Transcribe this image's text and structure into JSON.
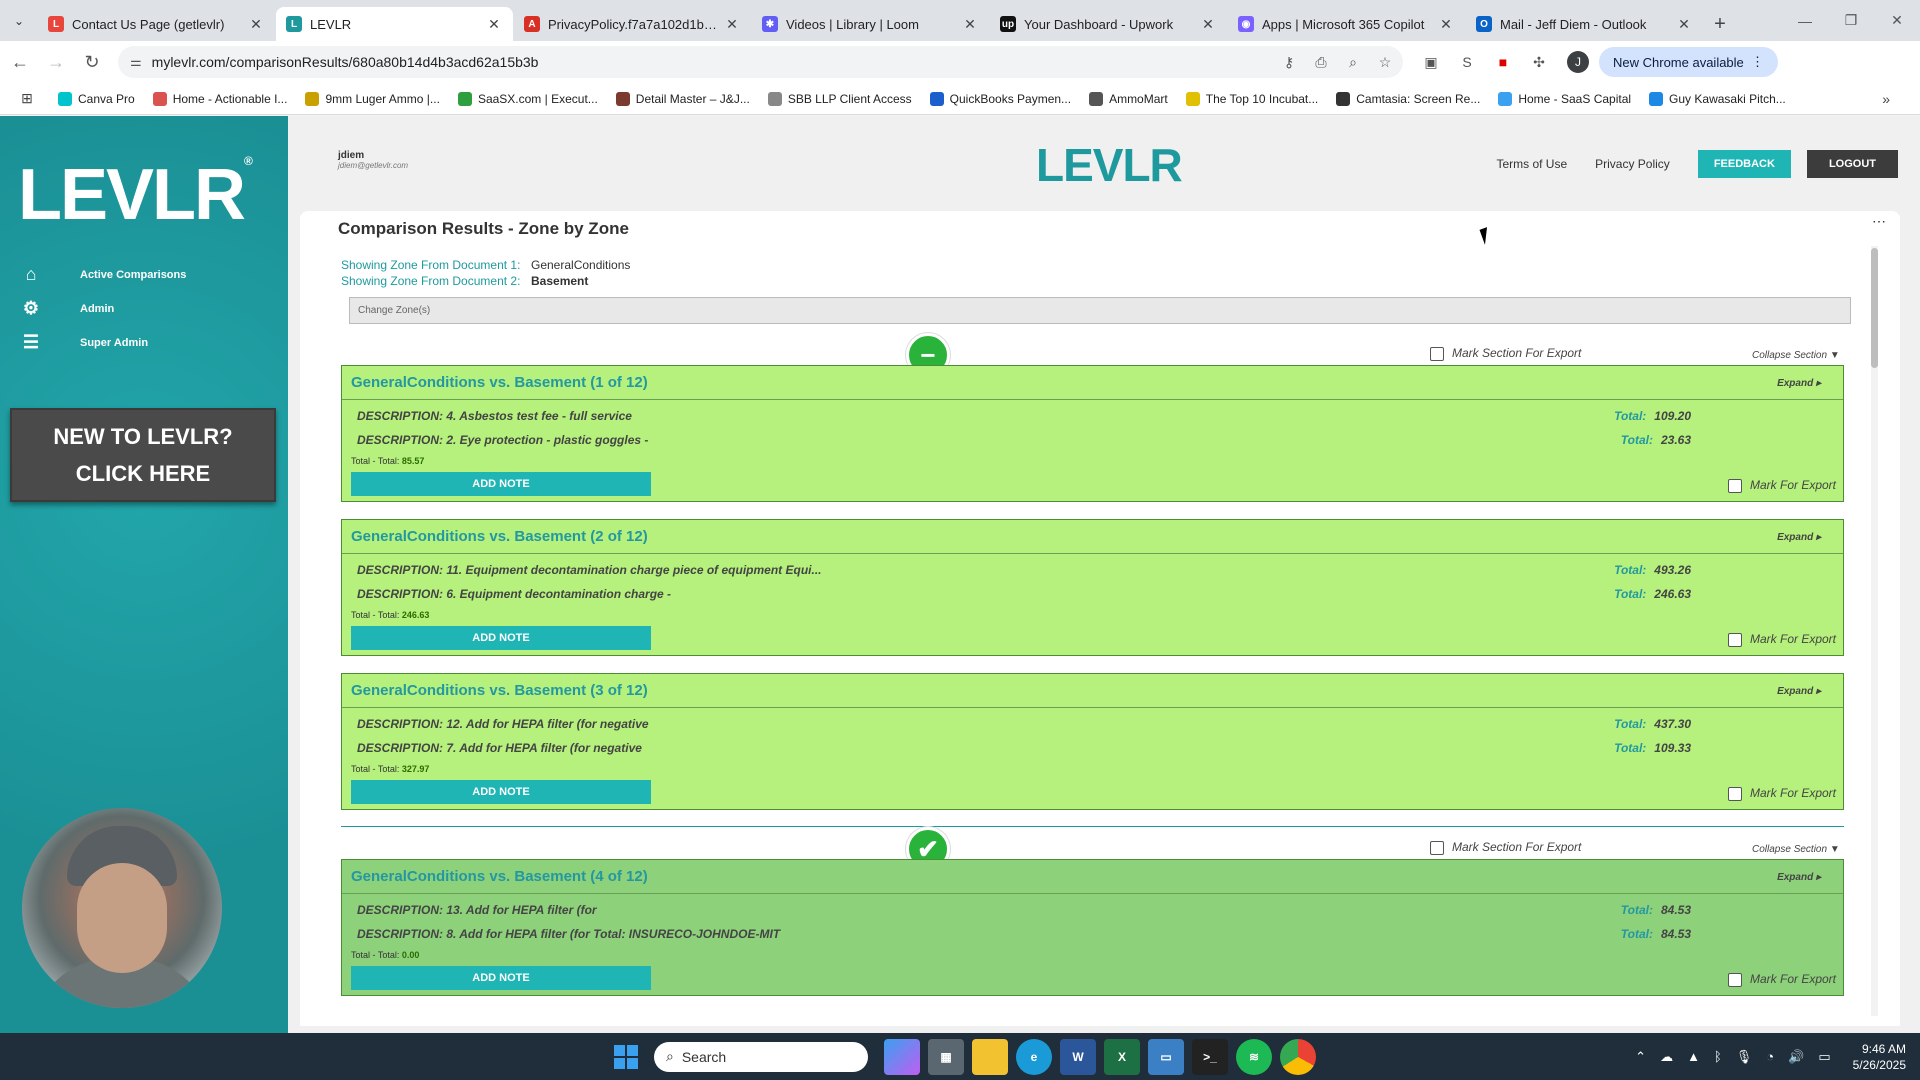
{
  "browser": {
    "tabs": [
      {
        "title": "Contact Us Page (getlevlr)",
        "color": "#e8453c",
        "glyph": "L"
      },
      {
        "title": "LEVLR",
        "color": "#1e9a9f",
        "glyph": "L",
        "active": true
      },
      {
        "title": "PrivacyPolicy.f7a7a102d1b144b",
        "color": "#d93025",
        "glyph": "A"
      },
      {
        "title": "Videos | Library | Loom",
        "color": "#625df5",
        "glyph": "✱"
      },
      {
        "title": "Your Dashboard - Upwork",
        "color": "#111",
        "glyph": "up"
      },
      {
        "title": "Apps | Microsoft 365 Copilot",
        "color": "#7b61ff",
        "glyph": "◉"
      },
      {
        "title": "Mail - Jeff Diem - Outlook",
        "color": "#0a64c8",
        "glyph": "O"
      }
    ],
    "url": "mylevlr.com/comparisonResults/680a80b14d4b3acd62a15b3b",
    "profile_initial": "J",
    "update_label": "New Chrome available",
    "bookmarks": [
      {
        "label": "Canva Pro",
        "color": "#00c4cc"
      },
      {
        "label": "Home - Actionable I...",
        "color": "#d9534f"
      },
      {
        "label": "9mm Luger Ammo |...",
        "color": "#c8a100"
      },
      {
        "label": "SaaSX.com | Execut...",
        "color": "#2e9e3e"
      },
      {
        "label": "Detail Master – J&J...",
        "color": "#7a3b2e"
      },
      {
        "label": "SBB LLP Client Access",
        "color": "#888"
      },
      {
        "label": "QuickBooks Paymen...",
        "color": "#1c5fcc"
      },
      {
        "label": "AmmoMart",
        "color": "#555"
      },
      {
        "label": "The Top 10 Incubat...",
        "color": "#e0c000"
      },
      {
        "label": "Camtasia: Screen Re...",
        "color": "#333"
      },
      {
        "label": "Home - SaaS Capital",
        "color": "#3aa0f0"
      },
      {
        "label": "Guy Kawasaki Pitch...",
        "color": "#1e88e5"
      }
    ]
  },
  "sidebar": {
    "logo": "LEVLR",
    "nav": [
      {
        "label": "Active Comparisons",
        "icon": "home-icon",
        "glyph": "⌂"
      },
      {
        "label": "Admin",
        "icon": "sliders-icon",
        "glyph": "⚙"
      },
      {
        "label": "Super Admin",
        "icon": "list-icon",
        "glyph": "☰"
      }
    ],
    "promo_line1": "NEW TO LEVLR?",
    "promo_line2": "CLICK HERE"
  },
  "header": {
    "user_name": "jdiem",
    "user_email": "jdiem@getlevlr.com",
    "logo": "LEVLR",
    "terms": "Terms of Use",
    "privacy": "Privacy Policy",
    "feedback": "FEEDBACK",
    "logout": "LOGOUT"
  },
  "page": {
    "title": "Comparison Results - Zone by Zone",
    "doc1_label": "Showing Zone From Document 1:",
    "doc1_value": "GeneralConditions",
    "doc2_label": "Showing Zone From Document 2:",
    "doc2_value": "Basement",
    "change_zone": "Change Zone(s)",
    "mark_section": "Mark Section For Export",
    "collapse": "Collapse Section ▼",
    "expand": "Expand ▸",
    "add_note": "ADD NOTE",
    "mark_export": "Mark For Export",
    "total_label": "Total:",
    "sum_label": "Total - Total:"
  },
  "sections": [
    {
      "status": "minus",
      "cards": [
        {
          "title": "GeneralConditions vs. Basement  (1 of 12)",
          "line1": "DESCRIPTION: 4. Asbestos test fee - full service",
          "total1": "109.20",
          "line2": "DESCRIPTION: 2. Eye protection - plastic goggles -",
          "total2": "23.63",
          "sum": "85.57"
        },
        {
          "title": "GeneralConditions vs. Basement  (2 of 12)",
          "line1": "DESCRIPTION: 11. Equipment decontamination charge piece of equipment Equi...",
          "total1": "493.26",
          "line2": "DESCRIPTION: 6. Equipment decontamination charge -",
          "total2": "246.63",
          "sum": "246.63"
        },
        {
          "title": "GeneralConditions vs. Basement  (3 of 12)",
          "line1": "DESCRIPTION: 12. Add for HEPA filter (for negative",
          "total1": "437.30",
          "line2": "DESCRIPTION: 7. Add for HEPA filter (for negative",
          "total2": "109.33",
          "sum": "327.97"
        }
      ]
    },
    {
      "status": "check",
      "cards": [
        {
          "title": "GeneralConditions vs. Basement  (4 of 12)",
          "line1": "DESCRIPTION: 13. Add for HEPA filter (for",
          "total1": "84.53",
          "line2": "DESCRIPTION: 8. Add for HEPA filter (for Total: INSURECO-JOHNDOE-MIT",
          "total2": "84.53",
          "sum": "0.00"
        }
      ]
    }
  ],
  "taskbar": {
    "search": "Search",
    "time": "9:46 AM",
    "date": "5/26/2025"
  }
}
